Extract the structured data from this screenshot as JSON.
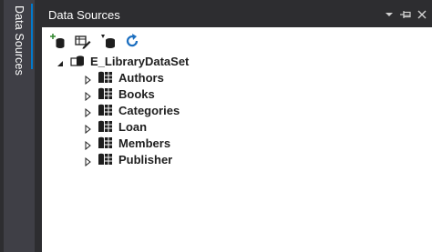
{
  "side_tab": {
    "label": "Data Sources"
  },
  "panel": {
    "title": "Data Sources",
    "title_buttons": [
      "dropdown-arrow-icon",
      "pin-icon",
      "close-icon"
    ]
  },
  "toolbar": {
    "tools": [
      "add-data-source-icon",
      "edit-dataset-icon",
      "configure-dataset-icon",
      "refresh-icon"
    ]
  },
  "tree": {
    "root": {
      "label": "E_LibraryDataSet",
      "icon": "dataset-icon",
      "expanded": true
    },
    "children": [
      {
        "label": "Authors",
        "icon": "table-icon"
      },
      {
        "label": "Books",
        "icon": "table-icon"
      },
      {
        "label": "Categories",
        "icon": "table-icon"
      },
      {
        "label": "Loan",
        "icon": "table-icon"
      },
      {
        "label": "Members",
        "icon": "table-icon"
      },
      {
        "label": "Publisher",
        "icon": "table-icon"
      }
    ]
  },
  "colors": {
    "chrome_dark": "#2d2d30",
    "tab_background": "#3f3f46",
    "accent": "#007acc",
    "add_green": "#388a34"
  }
}
